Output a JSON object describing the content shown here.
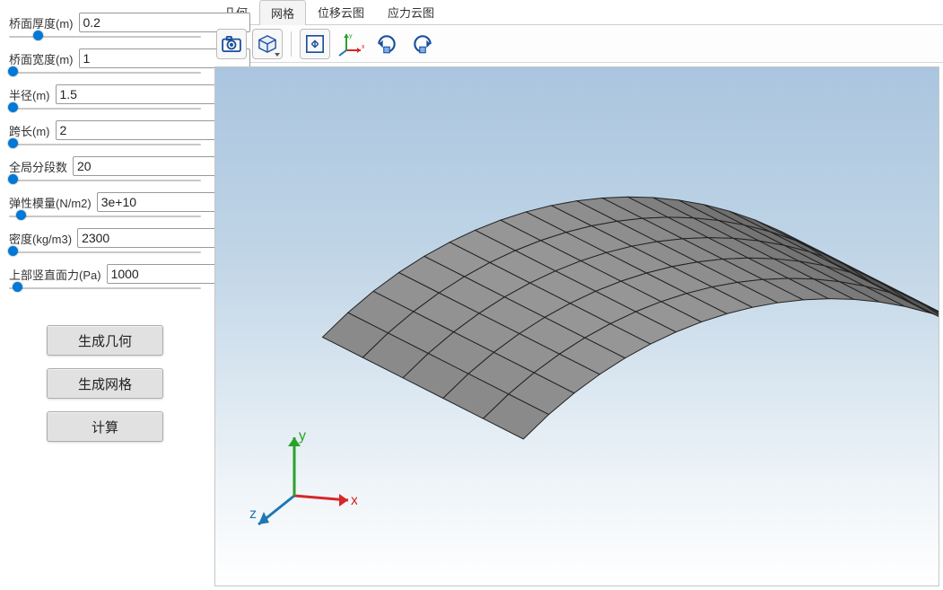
{
  "sidebar": {
    "params": [
      {
        "label": "桥面厚度(m)",
        "value": "0.2",
        "thumb_pct": 15
      },
      {
        "label": "桥面宽度(m)",
        "value": "1",
        "thumb_pct": 2
      },
      {
        "label": "半径(m)",
        "value": "1.5",
        "thumb_pct": 2
      },
      {
        "label": "跨长(m)",
        "value": "2",
        "thumb_pct": 2
      },
      {
        "label": "全局分段数",
        "value": "20",
        "thumb_pct": 2
      },
      {
        "label": "弹性模量(N/m2)",
        "value": "3e+10",
        "thumb_pct": 6
      },
      {
        "label": "密度(kg/m3)",
        "value": "2300",
        "thumb_pct": 2
      },
      {
        "label": "上部竖直面力(Pa)",
        "value": "1000",
        "thumb_pct": 4
      }
    ],
    "buttons": {
      "generate_geometry": "生成几何",
      "generate_mesh": "生成网格",
      "compute": "计算"
    }
  },
  "tabs": [
    {
      "id": "geometry",
      "label": "几何",
      "active": false
    },
    {
      "id": "mesh",
      "label": "网格",
      "active": true
    },
    {
      "id": "displacement",
      "label": "位移云图",
      "active": false
    },
    {
      "id": "stress",
      "label": "应力云图",
      "active": false
    }
  ],
  "toolbar": {
    "icons": {
      "screenshot": "screenshot-icon",
      "view_cube": "view-cube-icon",
      "fit": "fit-view-icon",
      "axes": "axes-toggle-icon",
      "rotate_ccw": "rotate-ccw-icon",
      "rotate_cw": "rotate-cw-icon"
    }
  },
  "viewport": {
    "axis_labels": {
      "x": "x",
      "y": "y",
      "z": "z"
    },
    "mesh": {
      "type": "curved-shell",
      "segments_u": 20,
      "segments_v": 5
    }
  }
}
